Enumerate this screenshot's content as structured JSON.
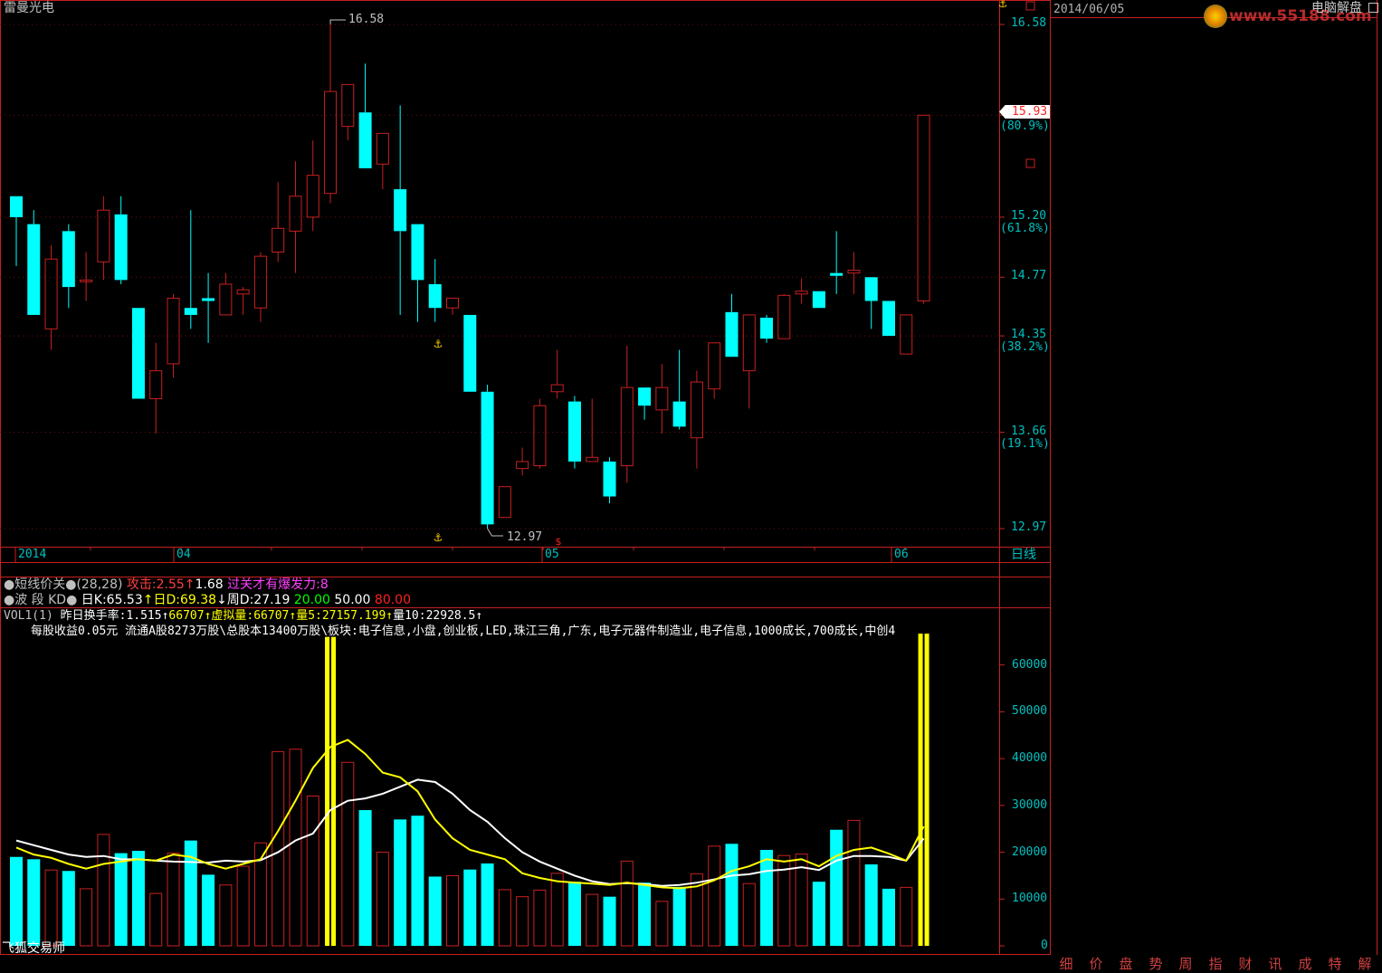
{
  "stock_name": "雷曼光电",
  "date": "2014/06/05",
  "right_panel_title": "电脑解盘",
  "watermark": "www.55188.com",
  "period_label": "日线",
  "price_axis": [
    {
      "value": 16.58,
      "pct": ""
    },
    {
      "value": 15.93,
      "pct": "(80.9%)"
    },
    {
      "value": 15.2,
      "pct": "(61.8%)"
    },
    {
      "value": 14.77,
      "pct": ""
    },
    {
      "value": 14.35,
      "pct": "(38.2%)"
    },
    {
      "value": 13.66,
      "pct": "(19.1%)"
    },
    {
      "value": 12.97,
      "pct": ""
    }
  ],
  "current_price": "15.93",
  "high_label": "16.58",
  "low_label": "12.97",
  "date_axis": [
    {
      "label": "2014",
      "x": 20
    },
    {
      "label": "04",
      "x": 195
    },
    {
      "label": "05",
      "x": 602
    },
    {
      "label": "06",
      "x": 988
    }
  ],
  "indicator1": {
    "name": "短线价关",
    "params": "(28,28)",
    "attack_label": "攻击:2.55",
    "value2": "1.68",
    "pass_text": "过关才有爆发力:8"
  },
  "indicator2": {
    "name": "波 段 KD",
    "dk": "日K:65.53",
    "dd": "日D:69.38",
    "wd": "周D:27.19",
    "l1": "20.00",
    "l2": "50.00",
    "l3": "80.00"
  },
  "volume": {
    "title": "VOL1(1)",
    "turnover": "昨日换手率:1.515",
    "vol": "66707",
    "virtual_vol": "虚拟量:66707",
    "ma5": "量5:27157.199",
    "ma10": "量10:22928.5",
    "info": "每股收益0.05元   流通A股8273万股\\总股本13400万股\\板块:电子信息,小盘,创业板,LED,珠江三角,广东,电子元器件制造业,电子信息,1000成长,700成长,中创4",
    "axis": [
      "60000",
      "50000",
      "40000",
      "30000",
      "20000",
      "10000",
      "0"
    ]
  },
  "footer_label": "飞狐交易师",
  "bottom_tabs": [
    "细",
    "价",
    "盘",
    "势",
    "周",
    "指",
    "财",
    "讯",
    "成",
    "特",
    "解"
  ],
  "chart_data": {
    "type": "candlestick",
    "ylim": [
      12.97,
      16.58
    ],
    "candles": [
      {
        "o": 15.35,
        "c": 15.2,
        "h": 15.35,
        "l": 14.85
      },
      {
        "o": 15.15,
        "c": 14.5,
        "h": 15.25,
        "l": 14.5
      },
      {
        "o": 14.4,
        "c": 14.9,
        "h": 15.0,
        "l": 14.25
      },
      {
        "o": 15.1,
        "c": 14.7,
        "h": 15.15,
        "l": 14.55
      },
      {
        "o": 14.75,
        "c": 14.75,
        "h": 14.95,
        "l": 14.6
      },
      {
        "o": 14.88,
        "c": 15.25,
        "h": 15.35,
        "l": 14.75
      },
      {
        "o": 15.22,
        "c": 14.75,
        "h": 15.35,
        "l": 14.72
      },
      {
        "o": 14.55,
        "c": 13.9,
        "h": 14.55,
        "l": 13.9
      },
      {
        "o": 13.9,
        "c": 14.1,
        "h": 14.3,
        "l": 13.65
      },
      {
        "o": 14.15,
        "c": 14.62,
        "h": 14.65,
        "l": 14.05
      },
      {
        "o": 14.55,
        "c": 14.5,
        "h": 15.25,
        "l": 14.4
      },
      {
        "o": 14.62,
        "c": 14.6,
        "h": 14.8,
        "l": 14.3
      },
      {
        "o": 14.5,
        "c": 14.72,
        "h": 14.8,
        "l": 14.5
      },
      {
        "o": 14.65,
        "c": 14.68,
        "h": 14.7,
        "l": 14.5
      },
      {
        "o": 14.55,
        "c": 14.92,
        "h": 14.95,
        "l": 14.45
      },
      {
        "o": 14.95,
        "c": 15.12,
        "h": 15.45,
        "l": 14.88
      },
      {
        "o": 15.1,
        "c": 15.35,
        "h": 15.6,
        "l": 14.8
      },
      {
        "o": 15.2,
        "c": 15.5,
        "h": 15.75,
        "l": 15.1
      },
      {
        "o": 15.37,
        "c": 16.1,
        "h": 16.58,
        "l": 15.3
      },
      {
        "o": 15.85,
        "c": 16.15,
        "h": 16.15,
        "l": 15.75
      },
      {
        "o": 15.95,
        "c": 15.55,
        "h": 16.3,
        "l": 15.55
      },
      {
        "o": 15.58,
        "c": 15.8,
        "h": 15.8,
        "l": 15.4
      },
      {
        "o": 15.4,
        "c": 15.1,
        "h": 16.0,
        "l": 14.5
      },
      {
        "o": 15.15,
        "c": 14.75,
        "h": 15.15,
        "l": 14.45
      },
      {
        "o": 14.72,
        "c": 14.55,
        "h": 14.9,
        "l": 14.45
      },
      {
        "o": 14.55,
        "c": 14.62,
        "h": 14.62,
        "l": 14.5
      },
      {
        "o": 14.5,
        "c": 13.95,
        "h": 14.5,
        "l": 13.95
      },
      {
        "o": 13.95,
        "c": 13.0,
        "h": 14.0,
        "l": 12.97
      },
      {
        "o": 13.05,
        "c": 13.27,
        "h": 13.27,
        "l": 13.05
      },
      {
        "o": 13.4,
        "c": 13.45,
        "h": 13.55,
        "l": 13.35
      },
      {
        "o": 13.42,
        "c": 13.85,
        "h": 13.9,
        "l": 13.4
      },
      {
        "o": 13.95,
        "c": 14.0,
        "h": 14.25,
        "l": 13.9
      },
      {
        "o": 13.88,
        "c": 13.45,
        "h": 13.92,
        "l": 13.4
      },
      {
        "o": 13.45,
        "c": 13.48,
        "h": 13.9,
        "l": 13.45
      },
      {
        "o": 13.45,
        "c": 13.2,
        "h": 13.48,
        "l": 13.15
      },
      {
        "o": 13.42,
        "c": 13.98,
        "h": 14.28,
        "l": 13.3
      },
      {
        "o": 13.98,
        "c": 13.85,
        "h": 13.98,
        "l": 13.75
      },
      {
        "o": 13.82,
        "c": 13.98,
        "h": 14.15,
        "l": 13.65
      },
      {
        "o": 13.88,
        "c": 13.7,
        "h": 14.25,
        "l": 13.68
      },
      {
        "o": 13.62,
        "c": 14.02,
        "h": 14.1,
        "l": 13.4
      },
      {
        "o": 13.97,
        "c": 14.3,
        "h": 14.3,
        "l": 13.9
      },
      {
        "o": 14.52,
        "c": 14.2,
        "h": 14.65,
        "l": 14.2
      },
      {
        "o": 14.1,
        "c": 14.5,
        "h": 14.5,
        "l": 13.83
      },
      {
        "o": 14.48,
        "c": 14.33,
        "h": 14.5,
        "l": 14.3
      },
      {
        "o": 14.33,
        "c": 14.64,
        "h": 14.65,
        "l": 14.33
      },
      {
        "o": 14.65,
        "c": 14.67,
        "h": 14.76,
        "l": 14.58
      },
      {
        "o": 14.67,
        "c": 14.55,
        "h": 14.67,
        "l": 14.55
      },
      {
        "o": 14.8,
        "c": 14.78,
        "h": 15.1,
        "l": 14.65
      },
      {
        "o": 14.8,
        "c": 14.82,
        "h": 14.95,
        "l": 14.65
      },
      {
        "o": 14.77,
        "c": 14.6,
        "h": 14.77,
        "l": 14.4
      },
      {
        "o": 14.6,
        "c": 14.35,
        "h": 14.6,
        "l": 14.35
      },
      {
        "o": 14.22,
        "c": 14.5,
        "h": 14.5,
        "l": 14.22
      },
      {
        "o": 14.6,
        "c": 15.93,
        "h": 15.93,
        "l": 14.58
      }
    ],
    "volumes": [
      19000,
      18500,
      16200,
      16000,
      12200,
      23800,
      19800,
      20300,
      11200,
      19800,
      22500,
      15200,
      13000,
      17000,
      22000,
      41500,
      42000,
      32000,
      66000,
      39200,
      29000,
      20000,
      27000,
      27800,
      14800,
      15000,
      16300,
      17600,
      12000,
      10500,
      11900,
      15500,
      13700,
      11000,
      10500,
      18100,
      13500,
      9500,
      12600,
      15400,
      21300,
      21800,
      13300,
      20500,
      19300,
      19600,
      13700,
      24800,
      26800,
      17400,
      12200,
      12500,
      66707
    ],
    "ma5": [
      21000,
      19500,
      18800,
      17500,
      16500,
      17500,
      18000,
      18500,
      18200,
      19500,
      19000,
      17500,
      16500,
      17500,
      18500,
      24500,
      31000,
      38000,
      42500,
      44000,
      41000,
      37000,
      36000,
      33000,
      27000,
      23000,
      20500,
      19500,
      18500,
      15500,
      14500,
      13800,
      13500,
      13300,
      13000,
      13500,
      13000,
      12500,
      12300,
      12700,
      14000,
      16000,
      17000,
      18500,
      18000,
      18500,
      17000,
      19200,
      20500,
      21000,
      19700,
      18200,
      25500
    ],
    "ma10": [
      22500,
      21500,
      20500,
      19500,
      19000,
      19200,
      18500,
      18500,
      18200,
      18000,
      17900,
      17800,
      18200,
      18000,
      18300,
      20000,
      22500,
      24000,
      29000,
      31000,
      31500,
      32500,
      34000,
      35500,
      35000,
      32500,
      29000,
      26500,
      23000,
      20000,
      18000,
      16500,
      15000,
      13800,
      13200,
      13400,
      13200,
      12800,
      13000,
      13500,
      14200,
      15000,
      15300,
      16000,
      16300,
      16800,
      16200,
      18200,
      19200,
      19200,
      19000,
      18200,
      22928.5
    ]
  }
}
